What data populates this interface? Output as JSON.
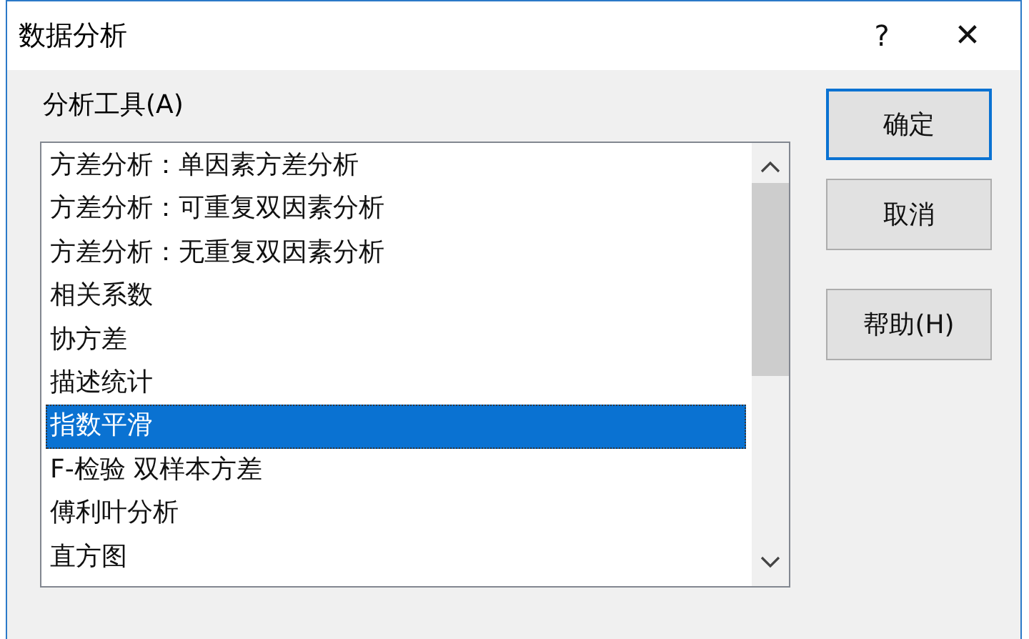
{
  "window": {
    "title": "数据分析",
    "help": "?",
    "close": "✕"
  },
  "tool_list": {
    "label": "分析工具(A)",
    "items": [
      {
        "text": "方差分析：单因素方差分析",
        "selected": false
      },
      {
        "text": "方差分析：可重复双因素分析",
        "selected": false
      },
      {
        "text": "方差分析：无重复双因素分析",
        "selected": false
      },
      {
        "text": "相关系数",
        "selected": false
      },
      {
        "text": "协方差",
        "selected": false
      },
      {
        "text": "描述统计",
        "selected": false
      },
      {
        "text": "指数平滑",
        "selected": true
      },
      {
        "text": "F-检验 双样本方差",
        "selected": false
      },
      {
        "text": "傅利叶分析",
        "selected": false
      },
      {
        "text": "直方图",
        "selected": false
      }
    ]
  },
  "buttons": [
    {
      "label": "确定",
      "default": true
    },
    {
      "label": "取消",
      "default": false
    },
    {
      "label": "帮助(H)",
      "default": false
    }
  ]
}
